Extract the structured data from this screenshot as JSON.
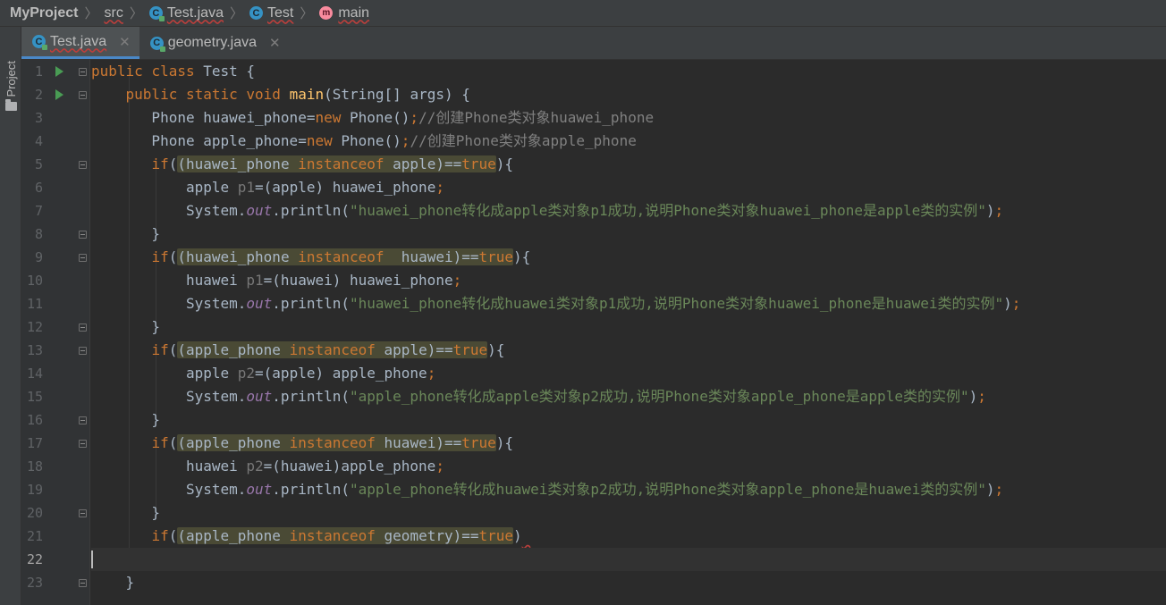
{
  "breadcrumb": {
    "project": "MyProject",
    "folder": "src",
    "file": "Test.java",
    "class": "Test",
    "method": "main",
    "class_icon": "c-class-icon",
    "method_icon": "m-method-icon"
  },
  "toolstrip": {
    "project_label": "Project"
  },
  "tabs": [
    {
      "label": "Test.java",
      "active": true
    },
    {
      "label": "geometry.java",
      "active": false
    }
  ],
  "editor": {
    "current_line": 22,
    "lines": [
      {
        "n": "1",
        "text": "public class Test {"
      },
      {
        "n": "2",
        "text": "    public static void main(String[] args) {"
      },
      {
        "n": "3",
        "text": "       Phone huawei_phone=new Phone();//创建Phone类对象huawei_phone"
      },
      {
        "n": "4",
        "text": "       Phone apple_phone=new Phone();//创建Phone类对象apple_phone"
      },
      {
        "n": "5",
        "text": "       if((huawei_phone instanceof apple)==true){"
      },
      {
        "n": "6",
        "text": "           apple p1=(apple) huawei_phone;"
      },
      {
        "n": "7",
        "text": "           System.out.println(\"huawei_phone转化成apple类对象p1成功,说明Phone类对象huawei_phone是apple类的实例\");"
      },
      {
        "n": "8",
        "text": "       }"
      },
      {
        "n": "9",
        "text": "       if((huawei_phone instanceof  huawei)==true){"
      },
      {
        "n": "10",
        "text": "           huawei p1=(huawei) huawei_phone;"
      },
      {
        "n": "11",
        "text": "           System.out.println(\"huawei_phone转化成huawei类对象p1成功,说明Phone类对象huawei_phone是huawei类的实例\");"
      },
      {
        "n": "12",
        "text": "       }"
      },
      {
        "n": "13",
        "text": "       if((apple_phone instanceof apple)==true){"
      },
      {
        "n": "14",
        "text": "           apple p2=(apple) apple_phone;"
      },
      {
        "n": "15",
        "text": "           System.out.println(\"apple_phone转化成apple类对象p2成功,说明Phone类对象apple_phone是apple类的实例\");"
      },
      {
        "n": "16",
        "text": "       }"
      },
      {
        "n": "17",
        "text": "       if((apple_phone instanceof huawei)==true){"
      },
      {
        "n": "18",
        "text": "           huawei p2=(huawei)apple_phone;"
      },
      {
        "n": "19",
        "text": "           System.out.println(\"apple_phone转化成huawei类对象p2成功,说明Phone类对象apple_phone是huawei类的实例\");"
      },
      {
        "n": "20",
        "text": "       }"
      },
      {
        "n": "21",
        "text": "       if((apple_phone instanceof geometry)==true)"
      },
      {
        "n": "22",
        "text": ""
      },
      {
        "n": "23",
        "text": "    }"
      }
    ]
  },
  "colors": {
    "keyword": "#cc7832",
    "method": "#ffc66d",
    "string": "#6a8759",
    "comment": "#808080",
    "plain": "#a9b7c6",
    "static_field": "#9876aa",
    "run_icon": "#499c54",
    "error_underline": "#bc3f3c"
  }
}
